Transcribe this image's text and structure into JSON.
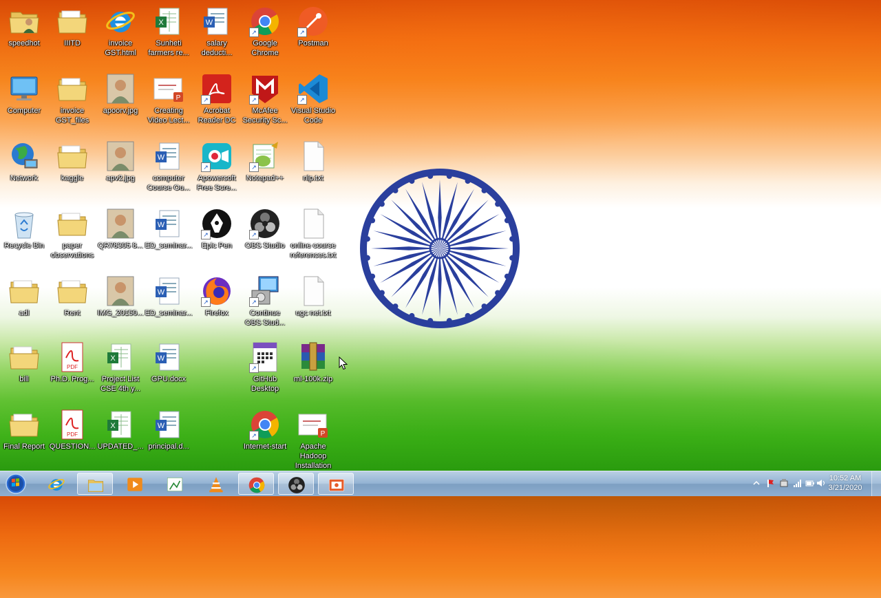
{
  "desktop": {
    "icons": [
      {
        "label": "speedhot",
        "icon": "folder-user-icon"
      },
      {
        "label": "IIITD",
        "icon": "folder-icon"
      },
      {
        "label": "invoice\nGST.html",
        "icon": "internet-explorer-icon"
      },
      {
        "label": "Sunheti\nfarmers re...",
        "icon": "excel-document-icon"
      },
      {
        "label": "salary\ndeducti...",
        "icon": "word-document-icon"
      },
      {
        "label": "Google\nChrome",
        "icon": "chrome-icon"
      },
      {
        "label": "Postman",
        "icon": "postman-icon"
      },
      {
        "label": "Computer",
        "icon": "computer-icon"
      },
      {
        "label": "invoice\nGST_files",
        "icon": "folder-icon"
      },
      {
        "label": "apoorv.jpg",
        "icon": "photo-icon"
      },
      {
        "label": "Creating\nVideo Lect...",
        "icon": "presentation-icon"
      },
      {
        "label": "Acrobat\nReader DC",
        "icon": "acrobat-icon"
      },
      {
        "label": "McAfee\nSecurity Sc...",
        "icon": "mcafee-icon"
      },
      {
        "label": "Visual Studio\nCode",
        "icon": "vscode-icon"
      },
      {
        "label": "Network",
        "icon": "network-globe-icon"
      },
      {
        "label": "kaggle",
        "icon": "folder-icon"
      },
      {
        "label": "apv2.jpg",
        "icon": "photo-icon"
      },
      {
        "label": "computer\nCourse Ou...",
        "icon": "word-document-icon"
      },
      {
        "label": "Apowersoft\nFree Scre...",
        "icon": "apowersoft-icon"
      },
      {
        "label": "Notepad++",
        "icon": "notepadpp-icon"
      },
      {
        "label": "nlp.txt",
        "icon": "text-file-icon"
      },
      {
        "label": "Recycle Bin",
        "icon": "recycle-bin-icon"
      },
      {
        "label": "paper\nobservations",
        "icon": "folder-icon"
      },
      {
        "label": "QR78305 8...",
        "icon": "photo-icon"
      },
      {
        "label": "ED_seminar...",
        "icon": "word-document-icon"
      },
      {
        "label": "Epic Pen",
        "icon": "epic-pen-icon"
      },
      {
        "label": "OBS Studio",
        "icon": "obs-icon"
      },
      {
        "label": "online course\nreferences.txt",
        "icon": "text-file-icon"
      },
      {
        "label": "adl",
        "icon": "folder-icon"
      },
      {
        "label": "Rent",
        "icon": "folder-icon"
      },
      {
        "label": "IMG_20150...",
        "icon": "photo-icon"
      },
      {
        "label": "ED_seminar...",
        "icon": "word-document-icon"
      },
      {
        "label": "Firefox",
        "icon": "firefox-icon"
      },
      {
        "label": "Continue\nOBS Stud...",
        "icon": "installer-icon"
      },
      {
        "label": "ugc net.txt",
        "icon": "text-file-icon"
      },
      {
        "label": "bill",
        "icon": "folder-icon"
      },
      {
        "label": "Ph.D. Prog...",
        "icon": "pdf-icon"
      },
      {
        "label": "Project List\nCSE 4th y...",
        "icon": "excel-document-icon"
      },
      {
        "label": "GPU.docx",
        "icon": "word-document-icon"
      },
      {
        "label": "GitHub\nDesktop",
        "icon": "github-desktop-icon"
      },
      {
        "label": "ml-100k.zip",
        "icon": "winrar-icon"
      },
      {
        "label": "Final Report",
        "icon": "folder-icon"
      },
      {
        "label": "QUESTION...",
        "icon": "pdf-icon"
      },
      {
        "label": "UPDATED_...",
        "icon": "excel-document-icon"
      },
      {
        "label": "principal.d...",
        "icon": "word-document-icon"
      },
      {
        "label": "Internet-start",
        "icon": "chrome-icon"
      },
      {
        "label": "Apache\nHadoop\nInstallation",
        "icon": "presentation-icon"
      }
    ]
  },
  "wallpaper": {
    "center_emblem": "ashoka-chakra-icon",
    "color": "#2a3f9d"
  },
  "taskbar": {
    "pinned": [
      {
        "icon": "internet-explorer-icon"
      },
      {
        "icon": "file-explorer-icon"
      },
      {
        "icon": "media-player-icon"
      },
      {
        "icon": "paint-icon"
      },
      {
        "icon": "vlc-icon"
      },
      {
        "icon": "chrome-icon"
      },
      {
        "icon": "obs-icon"
      },
      {
        "icon": "screen-recorder-icon"
      }
    ],
    "clock": {
      "time": "10:52 AM",
      "date": "3/21/2020"
    }
  }
}
